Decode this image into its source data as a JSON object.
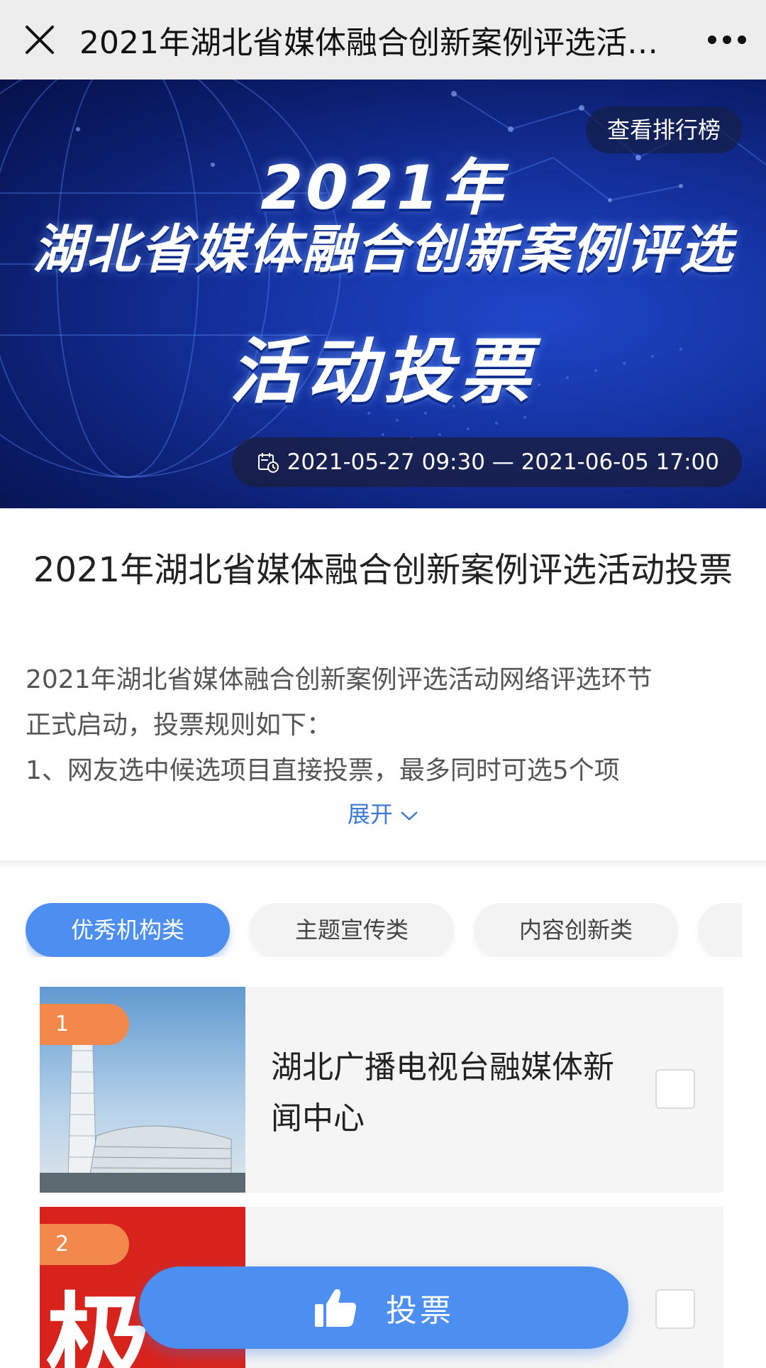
{
  "topbar": {
    "title": "2021年湖北省媒体融合创新案例评选活…",
    "close_icon": "close-icon",
    "more_icon": "more-dots-icon"
  },
  "banner": {
    "rank_button": "查看排行榜",
    "year_text": "2021年",
    "headline_line1": "湖北省媒体融合创新案例评选",
    "headline_line2": "活动投票",
    "date_range": "2021-05-27 09:30 — 2021-06-05 17:00",
    "calendar_icon": "calendar-clock-icon"
  },
  "intro": {
    "title": "2021年湖北省媒体融合创新案例评选活动投票",
    "description_lines": [
      "2021年湖北省媒体融合创新案例评选活动网络评选环节",
      "正式启动，投票规则如下：",
      "1、网友选中候选项目直接投票，最多同时可选5个项"
    ],
    "expand_label": "展开",
    "expand_icon": "chevron-down-icon"
  },
  "tabs": [
    {
      "label": "优秀机构类",
      "active": true
    },
    {
      "label": "主题宣传类",
      "active": false
    },
    {
      "label": "内容创新类",
      "active": false
    },
    {
      "label": "",
      "active": false
    }
  ],
  "candidates": [
    {
      "rank": "1",
      "name": "湖北广播电视台融媒体新闻中心",
      "thumb_glyph": "",
      "checked": false
    },
    {
      "rank": "2",
      "name": "",
      "thumb_glyph": "极",
      "checked": false
    }
  ],
  "vote_button": {
    "label": "投票",
    "icon": "thumbs-up-icon"
  },
  "colors": {
    "accent": "#4c8ff0",
    "badge": "#f2884b",
    "link": "#3a7bd5",
    "banner_dark": "#0a1c6a"
  }
}
